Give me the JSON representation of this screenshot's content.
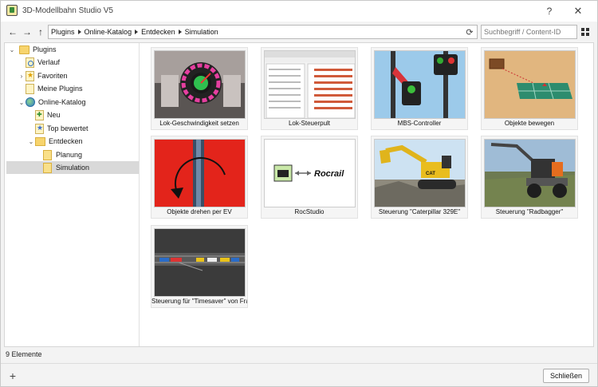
{
  "window": {
    "title": "3D-Modellbahn Studio V5"
  },
  "titlebar": {
    "help_label": "?",
    "close_label": "✕"
  },
  "nav": {
    "back_label": "←",
    "forward_label": "→",
    "up_label": "↑",
    "breadcrumb": [
      "Plugins",
      "Online-Katalog",
      "Entdecken",
      "Simulation"
    ],
    "refresh_label": "⟳",
    "search_placeholder": "Suchbegriff / Content-ID"
  },
  "tree": {
    "items": [
      {
        "label": "Plugins",
        "chevron": "⌄"
      },
      {
        "label": "Verlauf",
        "chevron": ""
      },
      {
        "label": "Favoriten",
        "chevron": "›"
      },
      {
        "label": "Meine Plugins",
        "chevron": ""
      },
      {
        "label": "Online-Katalog",
        "chevron": "⌄"
      },
      {
        "label": "Neu",
        "chevron": ""
      },
      {
        "label": "Top bewertet",
        "chevron": ""
      },
      {
        "label": "Entdecken",
        "chevron": "⌄"
      },
      {
        "label": "Planung",
        "chevron": ""
      },
      {
        "label": "Simulation",
        "chevron": ""
      }
    ]
  },
  "cards": [
    {
      "label": "Lok-Geschwindigkeit setzen"
    },
    {
      "label": "Lok-Steuerpult"
    },
    {
      "label": "MBS-Controller"
    },
    {
      "label": "Objekte bewegen"
    },
    {
      "label": "Objekte drehen per EV"
    },
    {
      "label": "RocStudio"
    },
    {
      "label": "Steuerung \"Caterpillar 329E\""
    },
    {
      "label": "Steuerung \"Radbagger\""
    },
    {
      "label": "Steuerung für \"Timesaver\" von Franz"
    }
  ],
  "thumb_text": {
    "rocrail": "Rocrail",
    "cat": "CAT"
  },
  "status": {
    "count_text": "9 Elemente"
  },
  "footer": {
    "add_label": "+",
    "close_button_label": "Schließen"
  },
  "colors": {
    "selected_bg": "#d9d9d9",
    "folder": "#f7d46d"
  }
}
